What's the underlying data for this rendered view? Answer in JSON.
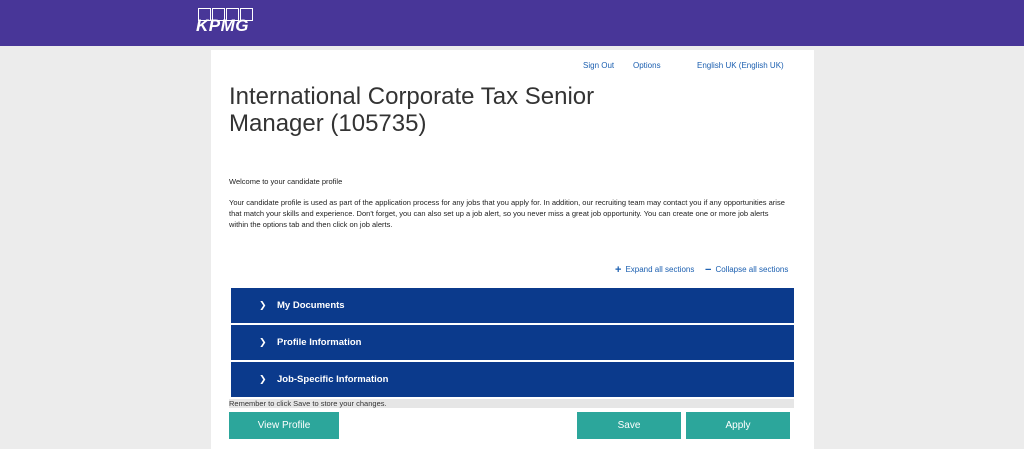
{
  "header": {
    "logo_text": "KPMG"
  },
  "nav": {
    "sign_out": "Sign Out",
    "options": "Options",
    "language": "English UK (English UK)"
  },
  "job": {
    "title": "International Corporate Tax Senior Manager (105735)"
  },
  "intro": {
    "welcome": "Welcome to your candidate profile",
    "body": "Your candidate profile is used as part of the application process for any jobs that you apply for. In addition, our recruiting team may contact you if any opportunities arise that match your skills and experience. Don't forget, you can also set up a job alert, so you never miss a great job opportunity. You can create one or more job alerts within the options tab and then click on job alerts."
  },
  "sections_controls": {
    "expand_all": "Expand all sections",
    "collapse_all": "Collapse all sections"
  },
  "sections": [
    {
      "label": "My Documents"
    },
    {
      "label": "Profile Information"
    },
    {
      "label": "Job-Specific Information"
    }
  ],
  "footer": {
    "notice": "Remember to click Save to store your changes.",
    "view_profile": "View Profile",
    "save": "Save",
    "apply": "Apply"
  },
  "colors": {
    "header": "#483698",
    "section": "#0b3a8c",
    "button": "#2ca69b",
    "link": "#1b5fb0"
  },
  "icons": {
    "expand": "plus-icon",
    "collapse": "minus-icon",
    "section": "chevron-right-icon"
  }
}
